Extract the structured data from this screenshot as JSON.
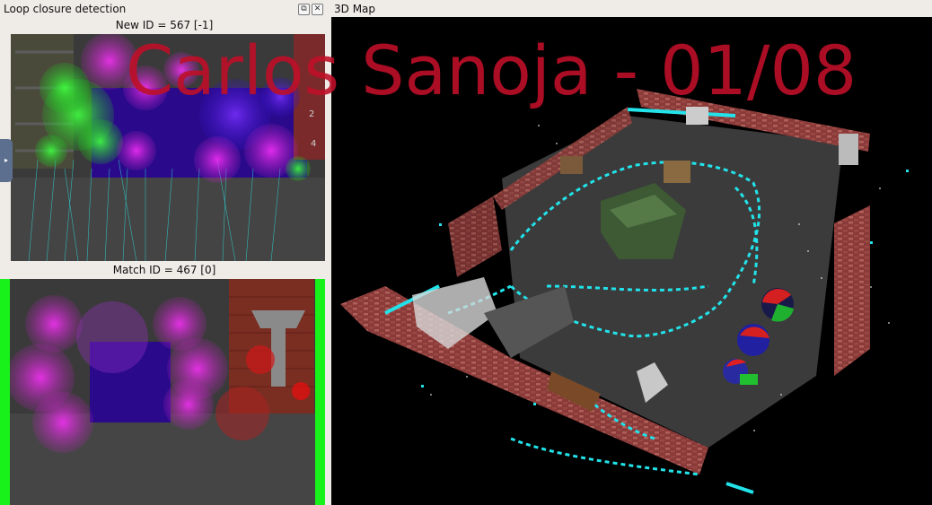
{
  "loop_panel": {
    "title": "Loop closure detection",
    "new_label": "New ID = 567 [-1]",
    "match_label": "Match ID = 467 [0]"
  },
  "map_panel": {
    "title": "3D Map"
  },
  "watermark": "Carlos Sanoja - 01/08",
  "colors": {
    "background": "#efebe7",
    "match_border": "#19f21a",
    "trajectory": "#22e3ea",
    "watermark": "#be1028"
  }
}
